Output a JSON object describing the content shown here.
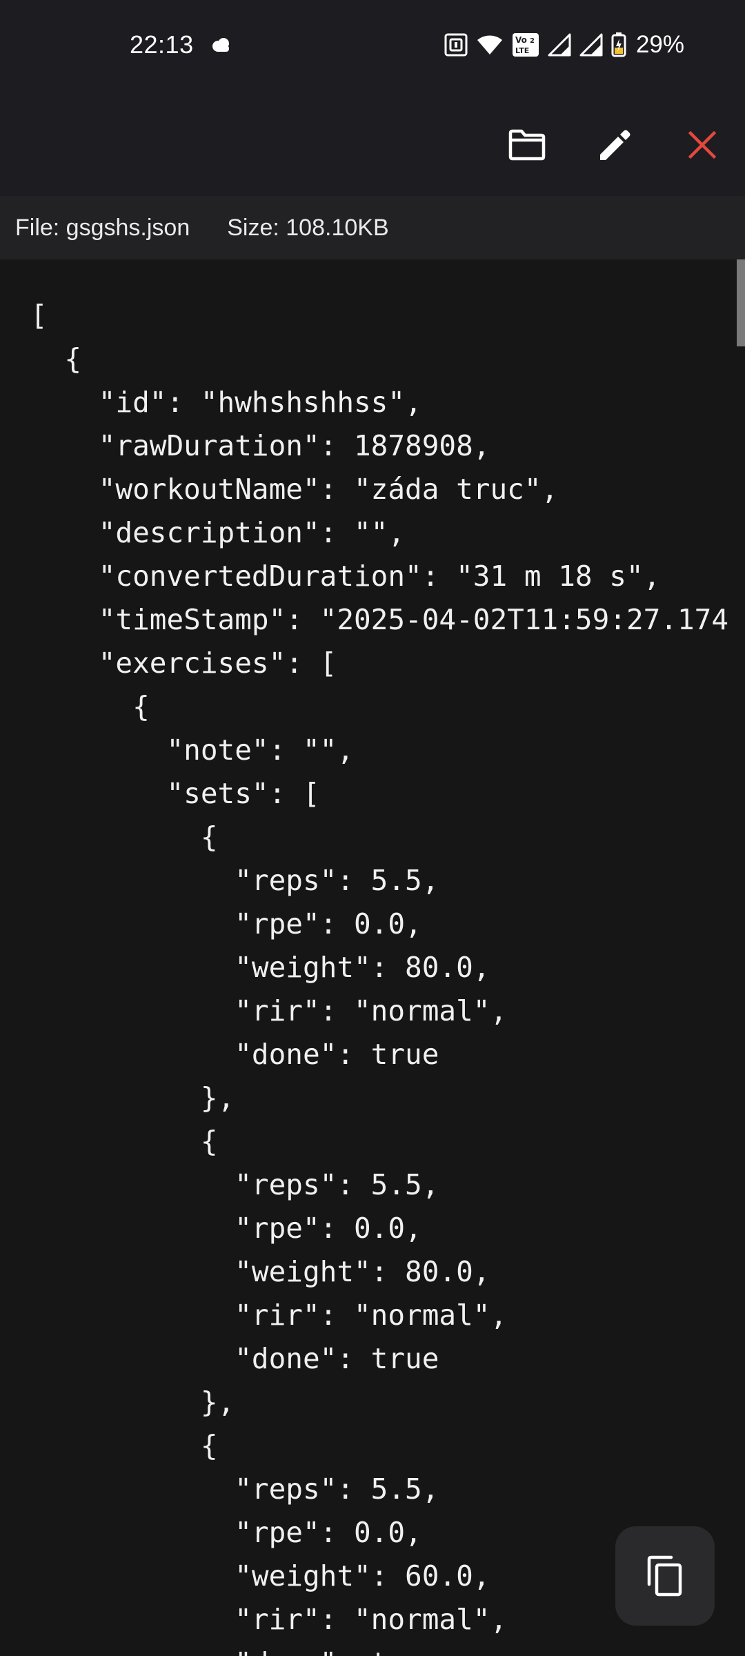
{
  "status_bar": {
    "time": "22:13",
    "battery": "29%",
    "icons": [
      "cloud-icon",
      "nfc-icon",
      "wifi-icon",
      "volte-icon",
      "signal-icon",
      "signal-icon",
      "battery-charging-icon"
    ],
    "volte_top": "Vo",
    "volte_sub": "2",
    "volte_bottom": "LTE"
  },
  "app_bar": {
    "actions": [
      "folder-icon",
      "edit-icon",
      "close-icon"
    ],
    "close_color": "#e5483d"
  },
  "info_bar": {
    "file": "File: gsgshs.json",
    "size": "Size: 108.10KB"
  },
  "code_lines": [
    "[",
    "  {",
    "    \"id\": \"hwhshshhss\",",
    "    \"rawDuration\": 1878908,",
    "    \"workoutName\": \"záda truc\",",
    "    \"description\": \"\",",
    "    \"convertedDuration\": \"31 m 18 s\",",
    "    \"timeStamp\": \"2025-04-02T11:59:27.174",
    "    \"exercises\": [",
    "      {",
    "        \"note\": \"\",",
    "        \"sets\": [",
    "          {",
    "            \"reps\": 5.5,",
    "            \"rpe\": 0.0,",
    "            \"weight\": 80.0,",
    "            \"rir\": \"normal\",",
    "            \"done\": true",
    "          },",
    "          {",
    "            \"reps\": 5.5,",
    "            \"rpe\": 0.0,",
    "            \"weight\": 80.0,",
    "            \"rir\": \"normal\",",
    "            \"done\": true",
    "          },",
    "          {",
    "            \"reps\": 5.5,",
    "            \"rpe\": 0.0,",
    "            \"weight\": 60.0,",
    "            \"rir\": \"normal\",",
    "            \"done\": true"
  ],
  "fab": {
    "icon": "copy-icon"
  }
}
